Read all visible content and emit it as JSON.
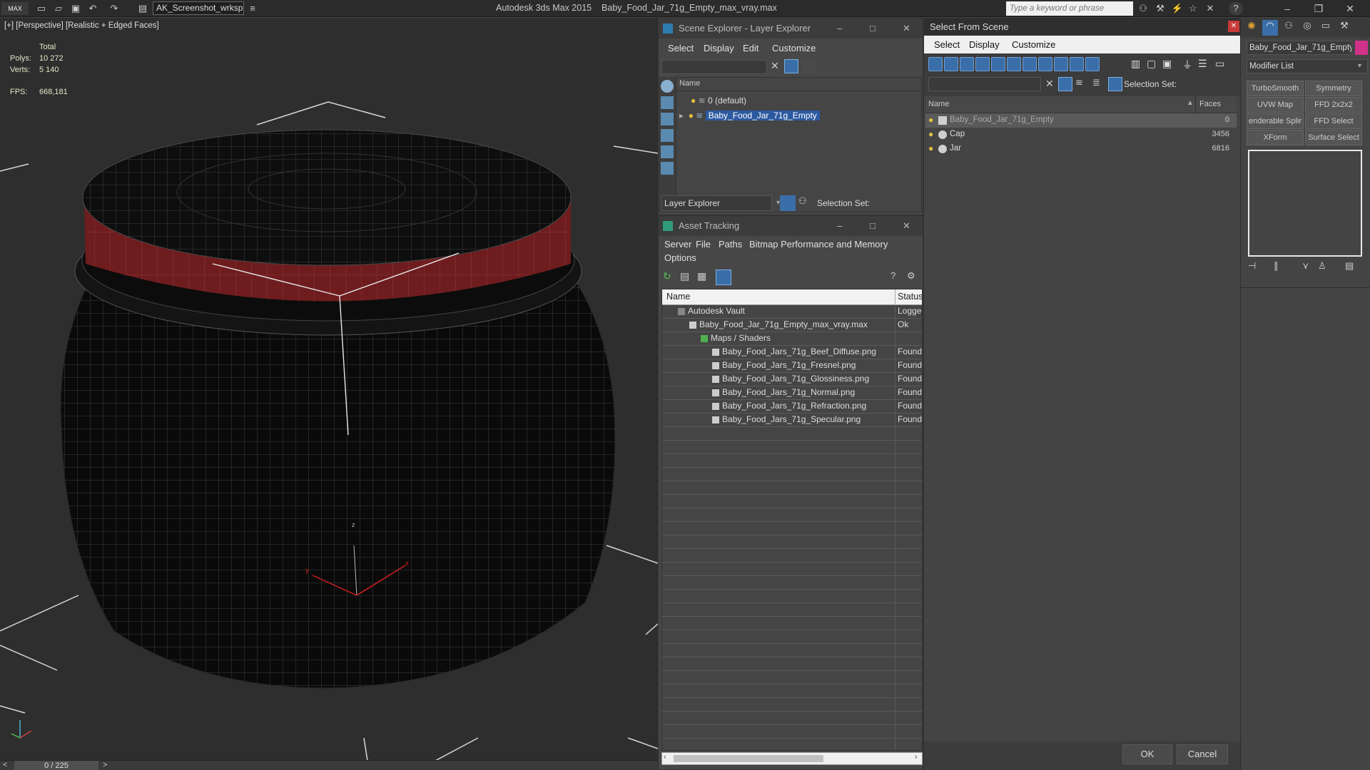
{
  "titlebar": {
    "logo": "MAX",
    "workspace": "AK_Screenshot_wrksp",
    "app_title": "Autodesk 3ds Max  2015",
    "file_title": "Baby_Food_Jar_71g_Empty_max_vray.max",
    "search_placeholder": "Type a keyword or phrase"
  },
  "viewport": {
    "label": "[+] [Perspective] [Realistic + Edged Faces]",
    "total_label": "Total",
    "polys_label": "Polys:",
    "polys_value": "10 272",
    "verts_label": "Verts:",
    "verts_value": "5 140",
    "fps_label": "FPS:",
    "fps_value": "668,181",
    "gizmo_x": "x",
    "gizmo_y": "y",
    "gizmo_z": "z"
  },
  "timeline": {
    "frame": "0 / 225"
  },
  "scene_explorer": {
    "title": "Scene Explorer - Layer Explorer",
    "menus": [
      "Select",
      "Display",
      "Edit",
      "Customize"
    ],
    "col_name": "Name",
    "rows": [
      "0 (default)",
      "Baby_Food_Jar_71g_Empty"
    ],
    "footer_dropdown": "Layer Explorer",
    "selection_set": "Selection Set:"
  },
  "asset_tracking": {
    "title": "Asset Tracking",
    "menus": [
      "Server",
      "File",
      "Paths",
      "Bitmap Performance and Memory",
      "Options"
    ],
    "col_name": "Name",
    "col_status": "Status",
    "rows": [
      {
        "name": "Autodesk Vault",
        "status": "Logged"
      },
      {
        "name": "Baby_Food_Jar_71g_Empty_max_vray.max",
        "status": "Ok"
      },
      {
        "name": "Maps / Shaders",
        "status": ""
      },
      {
        "name": "Baby_Food_Jars_71g_Beef_Diffuse.png",
        "status": "Found"
      },
      {
        "name": "Baby_Food_Jars_71g_Fresnel.png",
        "status": "Found"
      },
      {
        "name": "Baby_Food_Jars_71g_Glossiness.png",
        "status": "Found"
      },
      {
        "name": "Baby_Food_Jars_71g_Normal.png",
        "status": "Found"
      },
      {
        "name": "Baby_Food_Jars_71g_Refraction.png",
        "status": "Found"
      },
      {
        "name": "Baby_Food_Jars_71g_Specular.png",
        "status": "Found"
      }
    ]
  },
  "select_from_scene": {
    "title": "Select From Scene",
    "menus": [
      "Select",
      "Display",
      "Customize"
    ],
    "selection_set": "Selection Set:",
    "col_name": "Name",
    "col_faces": "Faces",
    "rows": [
      {
        "name": "Baby_Food_Jar_71g_Empty",
        "faces": "0"
      },
      {
        "name": "Cap",
        "faces": "3456"
      },
      {
        "name": "Jar",
        "faces": "6816"
      }
    ],
    "ok": "OK",
    "cancel": "Cancel"
  },
  "command_panel": {
    "object_name": "Baby_Food_Jar_71g_Empty",
    "modifier_list": "Modifier List",
    "buttons": [
      "TurboSmooth",
      "Symmetry",
      "UVW Map",
      "FFD 2x2x2",
      "enderable Splir",
      "FFD Select",
      "XForm",
      "Surface Select"
    ]
  },
  "colors": {
    "selection_blue": "#2c5aa0",
    "cap_red": "#6e1c1e",
    "viewport_bg": "#2e2e2e"
  }
}
